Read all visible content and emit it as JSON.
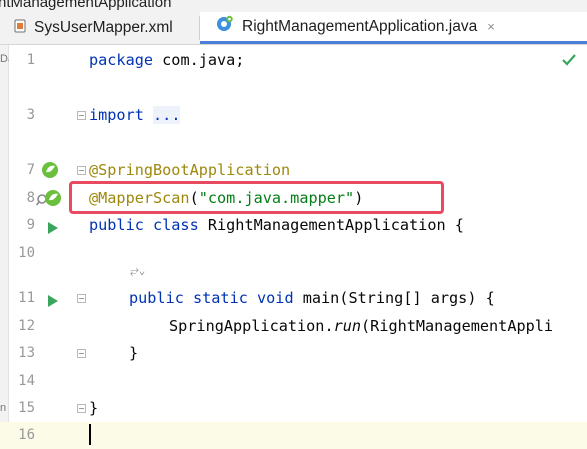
{
  "window": {
    "title_fragment": "ntManagementApplication"
  },
  "tabs": [
    {
      "label": "SysUserMapper.xml",
      "icon": "xml-file-icon",
      "active": false
    },
    {
      "label": "RightManagementApplication.java",
      "icon": "spring-class-icon",
      "active": true,
      "close": "×"
    }
  ],
  "editor": {
    "line_numbers": [
      "1",
      "3",
      "7",
      "8",
      "9",
      "10",
      "11",
      "12",
      "13",
      "14",
      "15",
      "16"
    ],
    "lines": {
      "l1": {
        "kw": "package",
        "rest": " com.java;"
      },
      "l3": {
        "kw": "import",
        "rest": " ",
        "folded": "..."
      },
      "l7": {
        "annotation": "@SpringBootApplication"
      },
      "l8": {
        "annotation": "@MapperScan",
        "open": "(",
        "string": "\"com.java.mapper\"",
        "close": ")"
      },
      "l9": {
        "kw": "public class",
        "rest": " RightManagementApplication {"
      },
      "l11": {
        "kw": "public static void",
        "rest": " main(String[] args) {"
      },
      "l12": {
        "rest": "SpringApplication.",
        "italic": "run",
        "rest2": "(RightManagementAppli"
      },
      "l13": {
        "rest": "}"
      },
      "l15": {
        "rest": "}"
      }
    },
    "inlay_hint": "⥂⌄",
    "status_icon": "check-icon",
    "highlight_color": "#e84a5f"
  },
  "left_panel": {
    "fragments": [
      "Da",
      "n"
    ]
  }
}
